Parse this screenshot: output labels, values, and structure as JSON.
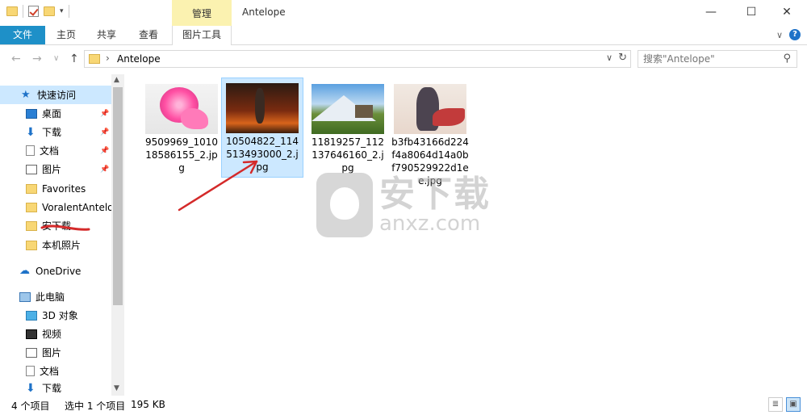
{
  "window": {
    "title": "Antelope",
    "context_tab": "管理",
    "minimize_glyph": "—",
    "maximize_glyph": "☐",
    "close_glyph": "✕"
  },
  "ribbon": {
    "tabs": [
      "文件",
      "主页",
      "共享",
      "查看",
      "图片工具"
    ],
    "expand_glyph": "∨",
    "help_glyph": "?"
  },
  "address": {
    "back_glyph": "←",
    "forward_glyph": "→",
    "recent_glyph": "∨",
    "up_glyph": "↑",
    "chevron": "›",
    "path": "Antelope",
    "dropdown_glyph": "∨",
    "refresh_glyph": "↻"
  },
  "search": {
    "placeholder": "搜索\"Antelope\"",
    "icon_glyph": "⚲"
  },
  "nav": {
    "quick_access": "快速访问",
    "items": [
      {
        "label": "桌面",
        "icon": "desktop-icon",
        "pinned": true
      },
      {
        "label": "下载",
        "icon": "download-icon",
        "pinned": true
      },
      {
        "label": "文档",
        "icon": "document-icon",
        "pinned": true
      },
      {
        "label": "图片",
        "icon": "picture-icon",
        "pinned": true
      },
      {
        "label": "Favorites",
        "icon": "folder-icon"
      },
      {
        "label": "VoralentAntelo",
        "icon": "folder-icon"
      },
      {
        "label": "安下载",
        "icon": "folder-icon"
      },
      {
        "label": "本机照片",
        "icon": "folder-icon"
      }
    ],
    "pin_glyph": "📌",
    "onedrive": "OneDrive",
    "this_pc": "此电脑",
    "pc_items": [
      {
        "label": "3D 对象",
        "icon": "3d-objects-icon"
      },
      {
        "label": "视频",
        "icon": "video-icon"
      },
      {
        "label": "图片",
        "icon": "picture-icon"
      },
      {
        "label": "文档",
        "icon": "document-icon"
      },
      {
        "label": "下载",
        "icon": "download-icon"
      }
    ],
    "scroll_up_glyph": "▲",
    "scroll_down_glyph": "▼"
  },
  "files": [
    {
      "name": "9509969_101018586155_2.jpg",
      "thumb": "flower",
      "selected": false
    },
    {
      "name": "10504822_114513493000_2.jpg",
      "thumb": "dark",
      "selected": true
    },
    {
      "name": "11819257_112137646160_2.jpg",
      "thumb": "mountain",
      "selected": false
    },
    {
      "name": "b3fb43166d224f4a8064d14a0bf790529922d1ee.jpg",
      "thumb": "warrior",
      "selected": false
    }
  ],
  "watermark": {
    "big": "安下载",
    "small": "anxz.com"
  },
  "status": {
    "count": "4 个项目",
    "selected": "选中 1 个项目",
    "size": "195 KB"
  },
  "colors": {
    "file_tab": "#1e90c8",
    "manage_tab": "#fbf2b0",
    "selection": "#cce8ff",
    "annotation": "#d42a2a"
  }
}
